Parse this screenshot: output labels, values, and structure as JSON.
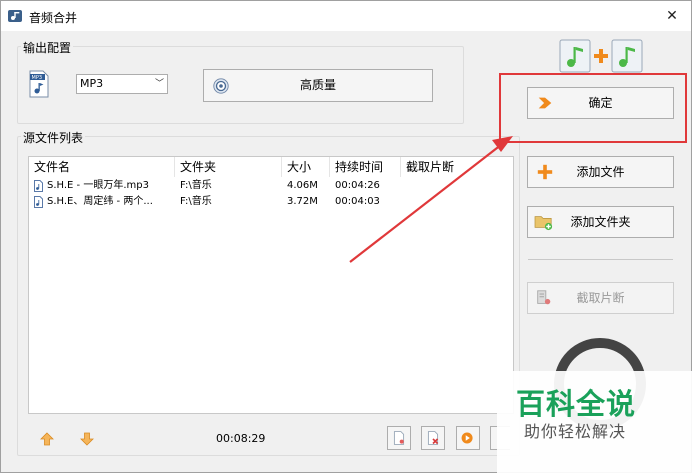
{
  "window": {
    "title": "音频合并",
    "close_glyph": "✕"
  },
  "output_config": {
    "group_label": "输出配置",
    "format_icon": "mp3-file-icon",
    "format_value": "MP3",
    "quality_button": "高质量"
  },
  "actions": {
    "confirm": "确定",
    "add_file": "添加文件",
    "add_folder": "添加文件夹",
    "trim": "截取片断"
  },
  "source_list": {
    "group_label": "源文件列表",
    "columns": [
      "文件名",
      "文件夹",
      "大小",
      "持续时间",
      "截取片断"
    ],
    "rows": [
      {
        "name": "S.H.E - 一眼万年.mp3",
        "folder": "F:\\音乐",
        "size": "4.06M",
        "duration": "00:04:26",
        "trim": ""
      },
      {
        "name": "S.H.E、周定纬 - 两个...",
        "folder": "F:\\音乐",
        "size": "3.72M",
        "duration": "00:04:03",
        "trim": ""
      }
    ]
  },
  "footer": {
    "total_duration": "00:08:29"
  },
  "watermark": {
    "title": "百科全说",
    "subtitle": "助你轻松解决"
  },
  "colors": {
    "annotation_red": "#e0383a",
    "watermark_green": "#1aa15a",
    "add_orange": "#f08a1c",
    "music_green": "#4cb848"
  }
}
